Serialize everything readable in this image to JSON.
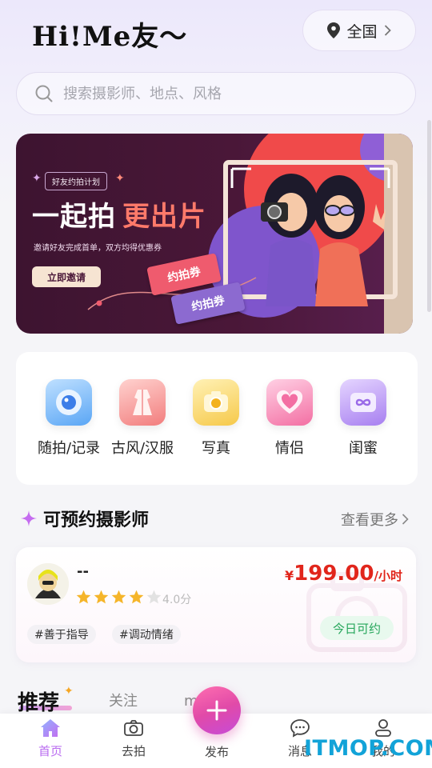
{
  "header": {
    "logo": "Hi!Me友〜",
    "city": "全国"
  },
  "search": {
    "placeholder": "搜索摄影师、地点、风格"
  },
  "banner": {
    "tag": "好友约拍计划",
    "headline_main": "一起拍",
    "headline_highlight": "更出片",
    "subtitle": "邀请好友完成首单，双方均得优惠券",
    "invite_button": "立即邀请",
    "ticket1": "约拍券",
    "ticket2": "约拍券"
  },
  "categories": [
    {
      "label": "随拍/记录",
      "icon": "camera-lens-icon",
      "color": "#5aa6f5"
    },
    {
      "label": "古风/汉服",
      "icon": "hanfu-dress-icon",
      "color": "#f27d7d"
    },
    {
      "label": "写真",
      "icon": "instant-camera-icon",
      "color": "#f6c94a"
    },
    {
      "label": "情侣",
      "icon": "heart-icon",
      "color": "#f36fa3"
    },
    {
      "label": "闺蜜",
      "icon": "infinity-icon",
      "color": "#a77ff0"
    }
  ],
  "section": {
    "title": "可预约摄影师",
    "more": "查看更多"
  },
  "photographer": {
    "name": "--",
    "rating": 4.0,
    "rating_text": "4.0分",
    "price_currency": "¥",
    "price": "199.00",
    "price_unit": "/小时",
    "tags": [
      "#善于指导",
      "#调动情绪"
    ],
    "availability": "今日可约"
  },
  "feed_tabs": [
    "推荐",
    "关注",
    "me圈"
  ],
  "bottom_nav": [
    {
      "label": "首页",
      "icon": "home-icon",
      "active": true
    },
    {
      "label": "去拍",
      "icon": "camera-icon",
      "active": false
    },
    {
      "label": "发布",
      "icon": "plus-icon",
      "active": false
    },
    {
      "label": "消息",
      "icon": "chat-bubble-icon",
      "active": false
    },
    {
      "label": "我的",
      "icon": "user-icon",
      "active": false
    }
  ],
  "watermark": "ITMOP.COM",
  "colors": {
    "accent": "#b96bf0",
    "price": "#e1251b",
    "available": "#26a65b"
  }
}
